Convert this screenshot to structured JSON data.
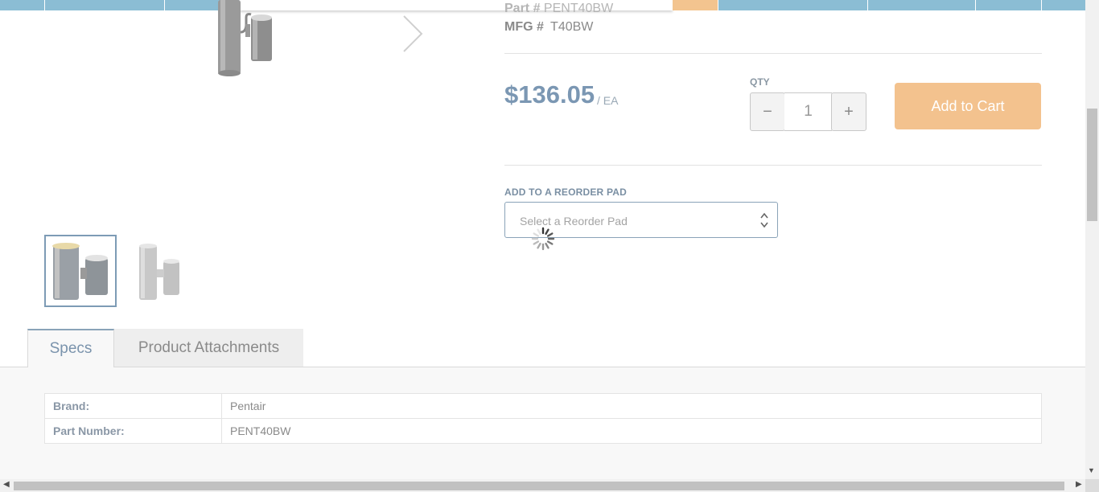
{
  "product": {
    "part_label": "Part #",
    "part_value": "PENT40BW",
    "mfg_label": "MFG #",
    "mfg_value": "T40BW",
    "price": "$136.05",
    "price_unit": "/ EA"
  },
  "quantity": {
    "label": "QTY",
    "value": "1",
    "minus": "−",
    "plus": "+"
  },
  "cart": {
    "add_label": "Add to Cart"
  },
  "reorder": {
    "label": "ADD TO A REORDER PAD",
    "placeholder": "Select a Reorder Pad"
  },
  "tabs": [
    {
      "label": "Specs",
      "active": true
    },
    {
      "label": "Product Attachments",
      "active": false
    }
  ],
  "specs": [
    {
      "key": "Brand:",
      "value": "Pentair"
    },
    {
      "key": "Part Number:",
      "value": "PENT40BW"
    }
  ],
  "colors": {
    "accent": "#7b97b3",
    "cart": "#f3c28e",
    "nav": "#8bbdd4"
  }
}
